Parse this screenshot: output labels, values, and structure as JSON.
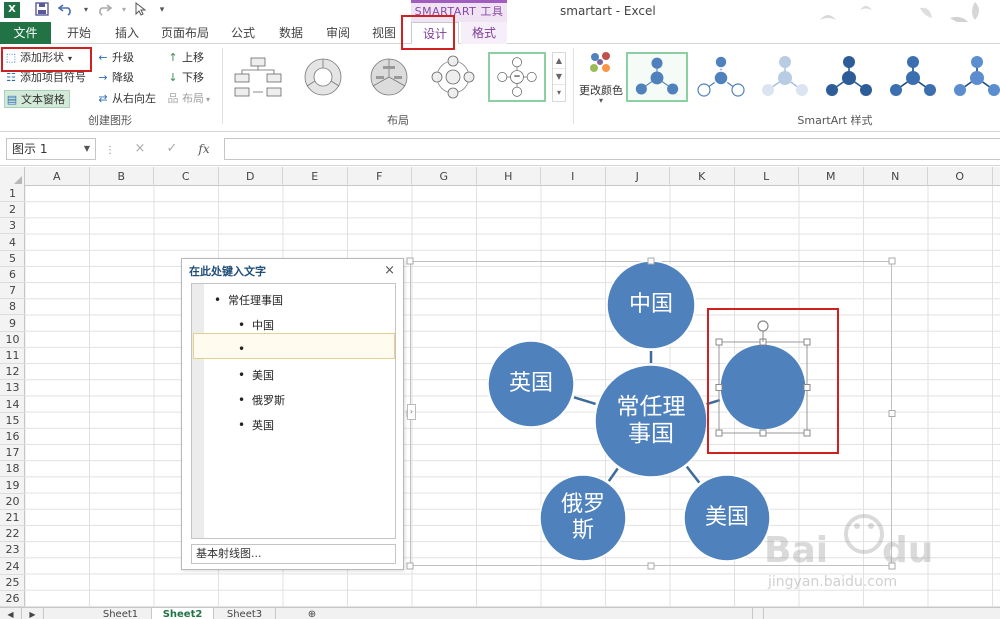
{
  "window": {
    "title": "smartart - Excel",
    "tool_tab_group": "SMARTART 工具",
    "app_icon": "X"
  },
  "quick_access": {
    "icons": [
      "excel-logo-icon",
      "save-icon",
      "undo-icon",
      "redo-icon",
      "pointer-icon",
      "customize-icon"
    ]
  },
  "tabs": [
    {
      "label": "文件"
    },
    {
      "label": "开始"
    },
    {
      "label": "插入"
    },
    {
      "label": "页面布局"
    },
    {
      "label": "公式"
    },
    {
      "label": "数据"
    },
    {
      "label": "审阅"
    },
    {
      "label": "视图"
    },
    {
      "label": "设计"
    },
    {
      "label": "格式"
    }
  ],
  "ribbon": {
    "create_graphic": {
      "add_shape": "添加形状",
      "add_bullet": "添加项目符号",
      "text_pane": "文本窗格",
      "promote": "升级",
      "demote": "降级",
      "right_to_left": "从右向左",
      "move_up": "上移",
      "move_down": "下移",
      "layout": "布局",
      "group_label": "创建图形"
    },
    "layouts": {
      "group_label": "布局"
    },
    "styles": {
      "change_colors": "更改颜色",
      "group_label": "SmartArt 样式"
    }
  },
  "formula_bar": {
    "name_box": "图示 1",
    "cancel_icon": "×",
    "enter_icon": "✓",
    "fx": "fx",
    "value": ""
  },
  "grid": {
    "columns": [
      "A",
      "B",
      "C",
      "D",
      "E",
      "F",
      "G",
      "H",
      "I",
      "J",
      "K",
      "L",
      "M",
      "N",
      "O"
    ],
    "rows": [
      "1",
      "2",
      "3",
      "4",
      "5",
      "6",
      "7",
      "8",
      "9",
      "10",
      "11",
      "12",
      "13",
      "14",
      "15",
      "16",
      "17",
      "18",
      "19",
      "20",
      "21",
      "22",
      "23",
      "24",
      "25",
      "26"
    ]
  },
  "text_pane": {
    "title": "在此处键入文字",
    "close": "×",
    "items": [
      {
        "level": 1,
        "text": "常任理事国"
      },
      {
        "level": 2,
        "text": "中国"
      },
      {
        "level": 2,
        "text": ""
      },
      {
        "level": 2,
        "text": "美国"
      },
      {
        "level": 2,
        "text": "俄罗斯"
      },
      {
        "level": 2,
        "text": "英国"
      }
    ],
    "footer": "基本射线图..."
  },
  "smartart": {
    "center": "常任理\n事国",
    "nodes": [
      "中国",
      "",
      "美国",
      "俄罗\n斯",
      "英国"
    ],
    "fill_color": "#4f81bd",
    "stroke_color": "#ffffff"
  },
  "sheets": [
    {
      "label": "Sheet1"
    },
    {
      "label": "Sheet2",
      "active": true
    },
    {
      "label": "Sheet3"
    }
  ],
  "colors": {
    "excel_green": "#217346",
    "tool_purple": "#7d3c98",
    "annotation_red": "#d02020",
    "node_blue": "#4f81bd"
  },
  "watermark": "jingyan.baidu.com"
}
